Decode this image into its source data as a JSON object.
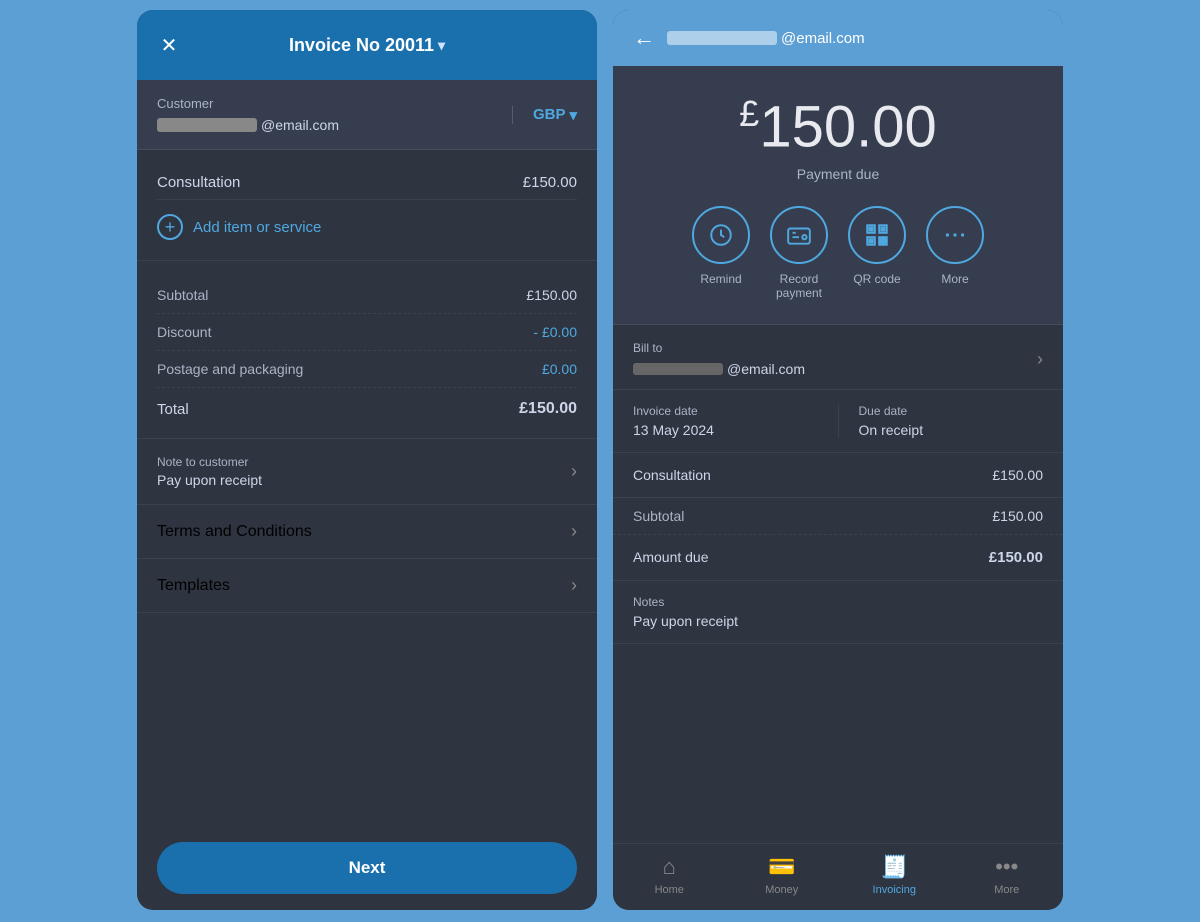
{
  "left": {
    "header": {
      "title": "Invoice No 20011",
      "dropdown_icon": "▾",
      "close_icon": "✕"
    },
    "customer": {
      "label": "Customer",
      "email_domain": "@email.com",
      "currency": "GBP"
    },
    "line_items": [
      {
        "name": "Consultation",
        "price": "£150.00"
      }
    ],
    "add_item_label": "Add item or service",
    "summary": [
      {
        "label": "Subtotal",
        "value": "£150.00",
        "type": "normal"
      },
      {
        "label": "Discount",
        "value": "- £0.00",
        "type": "discount"
      },
      {
        "label": "Postage and packaging",
        "value": "£0.00",
        "type": "postage"
      }
    ],
    "total_label": "Total",
    "total_value": "£150.00",
    "note": {
      "title": "Note to customer",
      "value": "Pay upon receipt"
    },
    "terms": {
      "title": "Terms and Conditions"
    },
    "templates": {
      "title": "Templates"
    },
    "next_button": "Next"
  },
  "right": {
    "header": {
      "email_domain": "@email.com",
      "back_icon": "←"
    },
    "payment": {
      "amount": "150.00",
      "currency_symbol": "£",
      "due_label": "Payment due"
    },
    "actions": [
      {
        "icon": "clock",
        "label": "Remind"
      },
      {
        "icon": "payment",
        "label": "Record\npayment"
      },
      {
        "icon": "qr",
        "label": "QR code"
      },
      {
        "icon": "more",
        "label": "More"
      }
    ],
    "bill_to": {
      "label": "Bill to",
      "email_domain": "@email.com"
    },
    "invoice_date": {
      "label": "Invoice date",
      "value": "13 May 2024"
    },
    "due_date": {
      "label": "Due date",
      "value": "On receipt"
    },
    "line_items": [
      {
        "name": "Consultation",
        "price": "£150.00"
      }
    ],
    "subtotal_label": "Subtotal",
    "subtotal_value": "£150.00",
    "amount_due_label": "Amount due",
    "amount_due_value": "£150.00",
    "notes": {
      "label": "Notes",
      "value": "Pay upon receipt"
    },
    "nav": [
      {
        "icon": "home",
        "label": "Home",
        "active": false
      },
      {
        "icon": "money",
        "label": "Money",
        "active": false
      },
      {
        "icon": "invoice",
        "label": "Invoicing",
        "active": true
      },
      {
        "icon": "more",
        "label": "More",
        "active": false
      }
    ]
  }
}
